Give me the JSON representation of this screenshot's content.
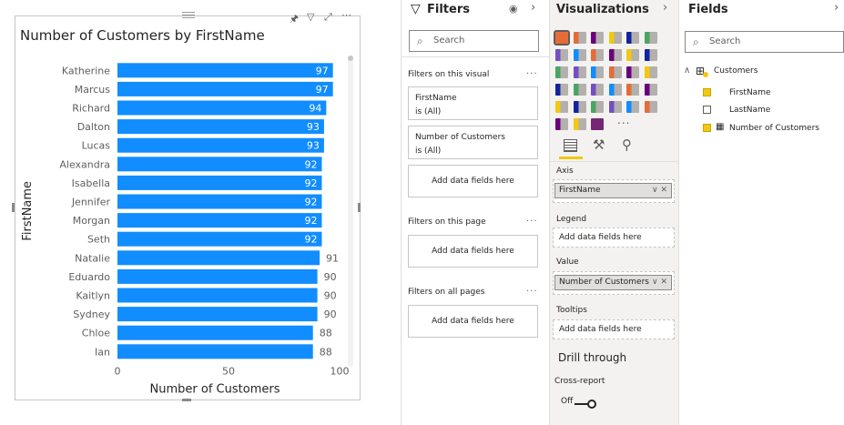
{
  "visual": {
    "title": "Number of Customers by FirstName",
    "header_icons": [
      "pin-icon",
      "filter-icon",
      "focus-mode-icon",
      "more-options-icon"
    ]
  },
  "chart_data": {
    "type": "bar",
    "orientation": "horizontal",
    "title": "Number of Customers by FirstName",
    "xlabel": "Number of Customers",
    "ylabel": "FirstName",
    "xlim": [
      0,
      100
    ],
    "xticks": [
      "0",
      "50",
      "100"
    ],
    "bar_color": "#118dff",
    "categories": [
      "Katherine",
      "Marcus",
      "Richard",
      "Dalton",
      "Lucas",
      "Alexandra",
      "Isabella",
      "Jennifer",
      "Morgan",
      "Seth",
      "Natalie",
      "Eduardo",
      "Kaitlyn",
      "Sydney",
      "Chloe",
      "Ian"
    ],
    "values": [
      97,
      97,
      94,
      93,
      93,
      92,
      92,
      92,
      92,
      92,
      91,
      90,
      90,
      90,
      88,
      88
    ],
    "data_labels_inside": [
      true,
      true,
      true,
      true,
      true,
      true,
      true,
      true,
      true,
      true,
      false,
      false,
      false,
      false,
      false,
      false
    ]
  },
  "filters": {
    "title": "Filters",
    "search_placeholder": "Search",
    "on_visual_label": "Filters on this visual",
    "cards": [
      {
        "field": "FirstName",
        "state": "is (All)"
      },
      {
        "field": "Number of Customers",
        "state": "is (All)"
      }
    ],
    "add_fields": "Add data fields here",
    "on_page_label": "Filters on this page",
    "all_pages_label": "Filters on all pages",
    "more": "..."
  },
  "visualizations": {
    "title": "Visualizations",
    "axis_label": "Axis",
    "axis_value": "FirstName",
    "legend_label": "Legend",
    "legend_value": "Add data fields here",
    "value_label": "Value",
    "value_value": "Number of Customers",
    "tooltips_label": "Tooltips",
    "tooltips_value": "Add data fields here",
    "drill_title": "Drill through",
    "cross_report": "Cross-report",
    "toggle_state": "Off",
    "more": "..."
  },
  "fields": {
    "title": "Fields",
    "search_placeholder": "Search",
    "table_name": "Customers",
    "items": [
      {
        "name": "FirstName",
        "checked": true
      },
      {
        "name": "LastName",
        "checked": false
      },
      {
        "name": "Number of Customers",
        "checked": true
      }
    ]
  }
}
